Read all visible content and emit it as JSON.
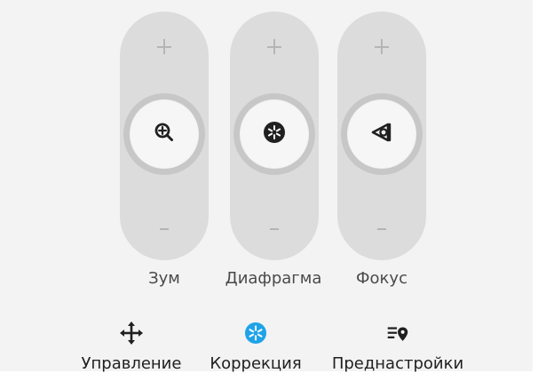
{
  "controls": {
    "zoom": {
      "label": "Зум",
      "icon": "zoom-in-icon",
      "plus_icon": "plus-icon",
      "minus_icon": "minus-icon"
    },
    "aperture": {
      "label": "Диафрагма",
      "icon": "aperture-icon",
      "plus_icon": "plus-icon",
      "minus_icon": "minus-icon"
    },
    "focus": {
      "label": "Фокус",
      "icon": "focus-eye-icon",
      "plus_icon": "plus-icon",
      "minus_icon": "minus-icon"
    }
  },
  "toolbar": {
    "items": [
      {
        "label": "Управление",
        "icon": "move-arrows-icon",
        "active": false
      },
      {
        "label": "Коррекция",
        "icon": "correction-snowflake-icon",
        "active": true
      },
      {
        "label": "Преднастройки",
        "icon": "presets-list-pin-icon",
        "active": false
      }
    ]
  },
  "colors": {
    "background": "#f3f3f3",
    "track": "#dcdcdc",
    "knob_ring": "#c7c7c7",
    "knob_face": "#f6f6f6",
    "label_text": "#4a4a4a",
    "toolbar_text": "#1f1f1f",
    "active_accent": "#1fa3e8"
  }
}
